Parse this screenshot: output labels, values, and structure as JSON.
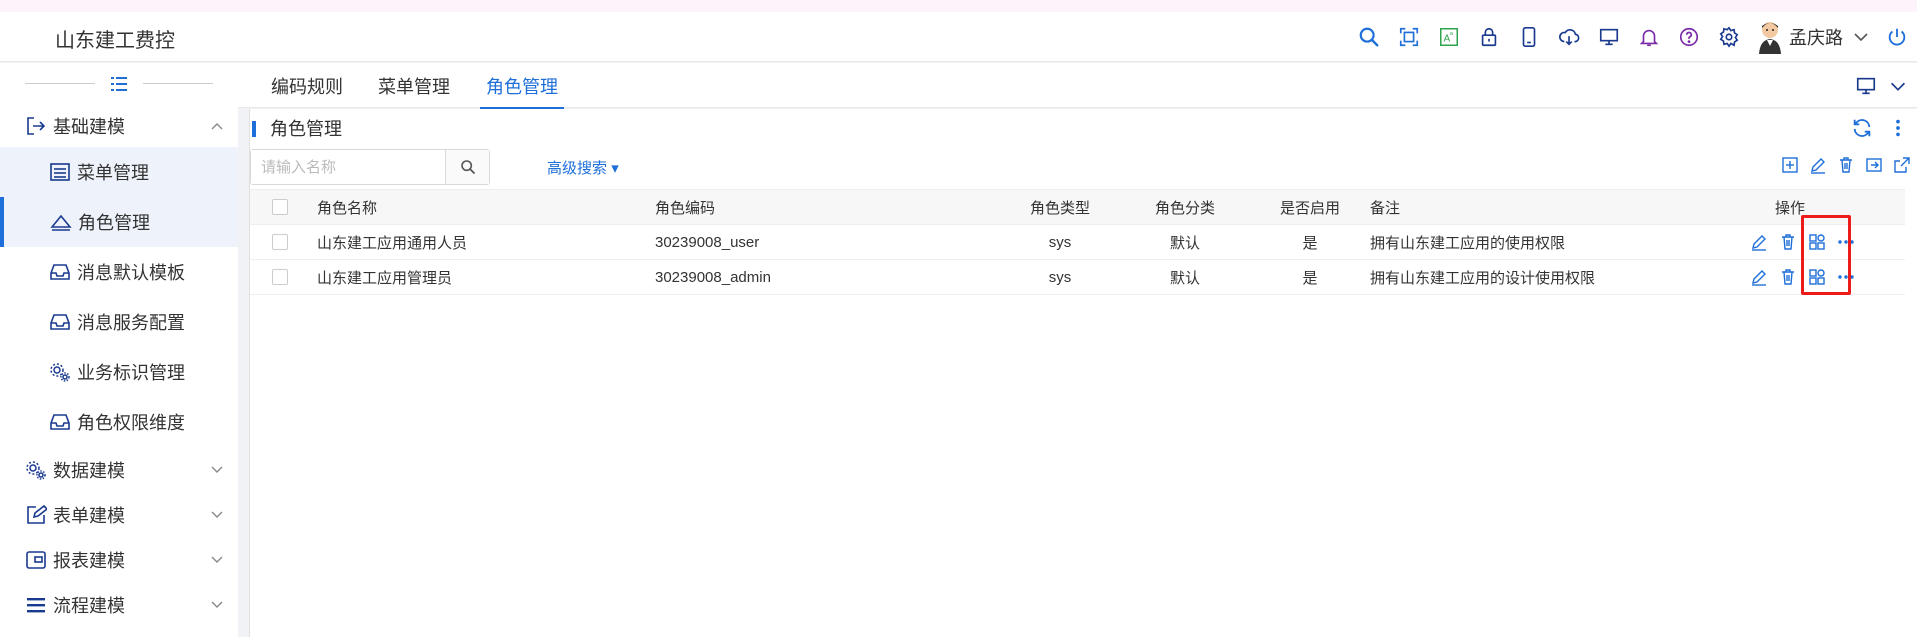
{
  "app": {
    "title": "山东建工费控"
  },
  "header": {
    "icons": [
      "search-icon",
      "fullscreen-icon",
      "font-size-icon",
      "lock-icon",
      "tablet-icon",
      "cloud-download-icon",
      "monitor-icon",
      "bell-icon",
      "help-icon",
      "settings-icon"
    ],
    "user_name": "孟庆路"
  },
  "sidebar": {
    "groups": [
      {
        "label": "基础建模",
        "expanded": true,
        "items": [
          {
            "label": "菜单管理",
            "icon": "menu-list-icon"
          },
          {
            "label": "角色管理",
            "icon": "role-icon",
            "active": true
          },
          {
            "label": "消息默认模板",
            "icon": "inbox-icon"
          },
          {
            "label": "消息服务配置",
            "icon": "inbox-icon"
          },
          {
            "label": "业务标识管理",
            "icon": "gears-icon"
          },
          {
            "label": "角色权限维度",
            "icon": "inbox-icon"
          }
        ]
      },
      {
        "label": "数据建模",
        "expanded": false
      },
      {
        "label": "表单建模",
        "expanded": false
      },
      {
        "label": "报表建模",
        "expanded": false
      },
      {
        "label": "流程建模",
        "expanded": false
      }
    ]
  },
  "tabs": [
    {
      "label": "编码规则"
    },
    {
      "label": "菜单管理"
    },
    {
      "label": "角色管理",
      "active": true
    }
  ],
  "panel": {
    "title": "角色管理",
    "search_placeholder": "请输入名称",
    "advanced_search": "高级搜索"
  },
  "table": {
    "columns": [
      "角色名称",
      "角色编码",
      "角色类型",
      "角色分类",
      "是否启用",
      "备注",
      "操作"
    ],
    "rows": [
      {
        "name": "山东建工应用通用人员",
        "code": "30239008_user",
        "type": "sys",
        "category": "默认",
        "enabled": "是",
        "remark": "拥有山东建工应用的使用权限"
      },
      {
        "name": "山东建工应用管理员",
        "code": "30239008_admin",
        "type": "sys",
        "category": "默认",
        "enabled": "是",
        "remark": "拥有山东建工应用的设计使用权限"
      }
    ]
  },
  "colors": {
    "accent": "#1e6fd9",
    "highlight": "#ee1b1b"
  }
}
